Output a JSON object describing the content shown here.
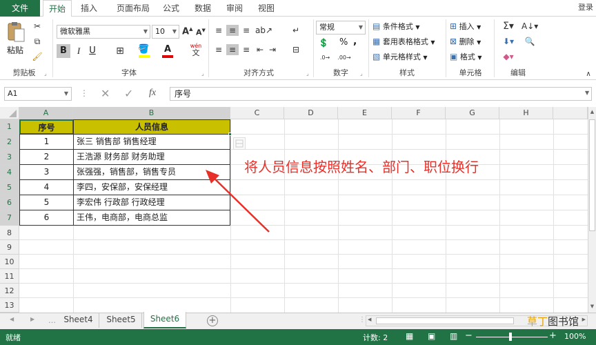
{
  "tabs": {
    "file": "文件",
    "home": "开始",
    "insert": "插入",
    "page_layout": "页面布局",
    "formulas": "公式",
    "data": "数据",
    "review": "审阅",
    "view": "视图",
    "login": "登录"
  },
  "ribbon": {
    "clipboard": {
      "paste": "粘贴",
      "label": "剪贴板"
    },
    "font": {
      "name": "微软雅黑",
      "size": "10",
      "label": "字体",
      "bold": "B",
      "italic": "I",
      "underline": "U",
      "grow": "A",
      "shrink": "A",
      "font_color_letter": "A",
      "wen": "wén"
    },
    "alignment": {
      "label": "对齐方式"
    },
    "number": {
      "format": "常规",
      "label": "数字",
      "percent": "%",
      "comma": ","
    },
    "styles": {
      "conditional": "条件格式",
      "table": "套用表格格式",
      "cell_styles": "单元格样式",
      "label": "样式"
    },
    "cells": {
      "insert": "插入",
      "delete": "删除",
      "format": "格式",
      "label": "单元格"
    },
    "editing": {
      "label": "编辑"
    }
  },
  "formula_bar": {
    "name_box": "A1",
    "fx": "fx",
    "content": "序号"
  },
  "columns": [
    "A",
    "B",
    "C",
    "D",
    "E",
    "F",
    "G",
    "H"
  ],
  "rows": [
    "1",
    "2",
    "3",
    "4",
    "5",
    "6",
    "7",
    "8",
    "9",
    "10",
    "11",
    "12",
    "13"
  ],
  "table": {
    "header": {
      "a": "序号",
      "b": "人员信息"
    },
    "data": [
      {
        "a": "1",
        "b": "张三 销售部 销售经理"
      },
      {
        "a": "2",
        "b": "王浩源 财务部 财务助理"
      },
      {
        "a": "3",
        "b": "张强强，销售部，销售专员"
      },
      {
        "a": "4",
        "b": "李四，安保部，安保经理"
      },
      {
        "a": "5",
        "b": "李宏伟 行政部 行政经理"
      },
      {
        "a": "6",
        "b": "王伟，电商部，电商总监"
      }
    ]
  },
  "annotation": {
    "text": "将人员信息按照姓名、部门、职位换行",
    "color": "#e8302a"
  },
  "sheets": [
    "Sheet4",
    "Sheet5",
    "Sheet6"
  ],
  "active_sheet": "Sheet6",
  "status": {
    "ready": "就绪",
    "count": "计数: 2",
    "zoom": "100%"
  },
  "watermark": {
    "text1": "草丁",
    "text2": "图书馆"
  },
  "colors": {
    "excel_green": "#217346",
    "header_fill": "#c9c000"
  }
}
